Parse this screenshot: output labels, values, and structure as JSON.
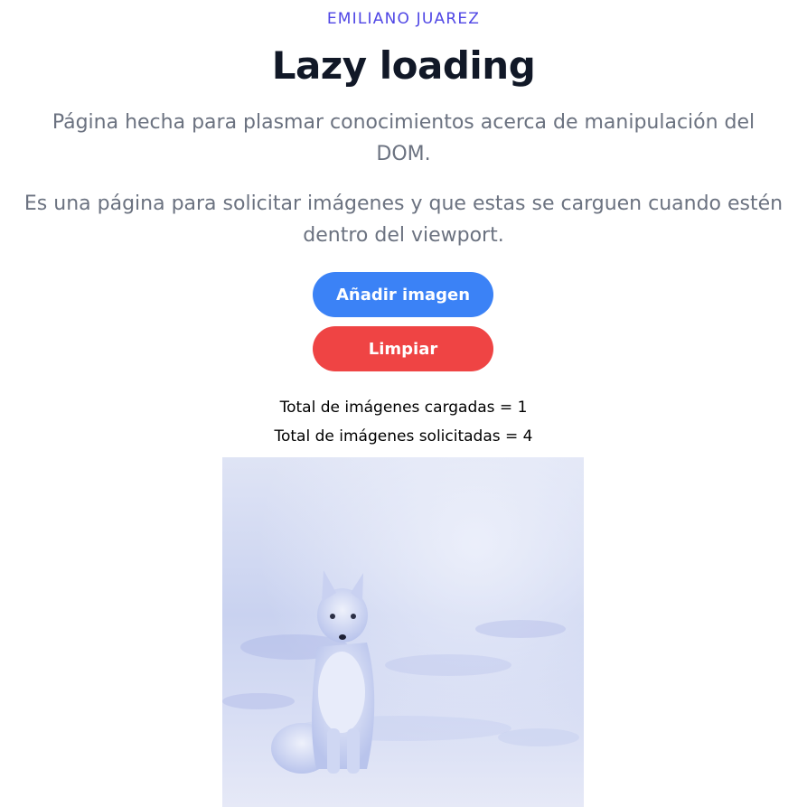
{
  "header": {
    "author": "EMILIANO JUAREZ",
    "title": "Lazy loading",
    "description_1": "Página hecha para plasmar conocimientos acerca de manipulación del DOM.",
    "description_2": "Es una página para solicitar imágenes y que estas se carguen cuando estén dentro del viewport."
  },
  "actions": {
    "add_label": "Añadir imagen",
    "clear_label": "Limpiar"
  },
  "stats": {
    "loaded_text": "Total de imágenes cargadas = 1",
    "requested_text": "Total de imágenes solicitadas = 4"
  },
  "images": [
    {
      "subject": "arctic-fox-in-snow"
    }
  ],
  "colors": {
    "author": "#4f46e5",
    "add_button": "#3b82f6",
    "clear_button": "#ef4444",
    "description_text": "#6b7280"
  }
}
